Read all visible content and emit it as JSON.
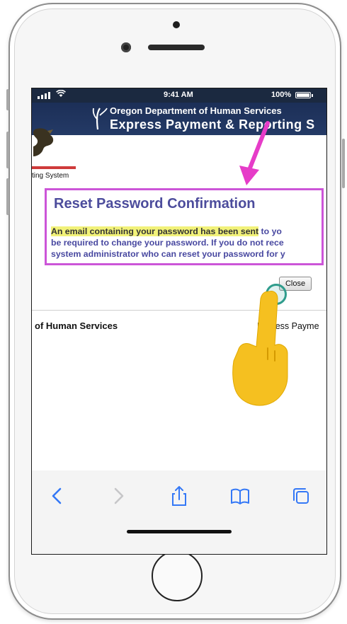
{
  "status_bar": {
    "time": "9:41 AM",
    "battery_percent": "100%",
    "battery_level": 1.0
  },
  "site_header": {
    "line1": "Oregon Department of Human Services",
    "line2": "Express Payment & Reporting S"
  },
  "site_subtitle": "ting System",
  "dialog": {
    "title": "Reset Password Confirmation",
    "message_highlighted": "An email containing your password has been sent",
    "message_rest_line1": " to yo",
    "message_line2": "be required to change your password. If you do not rece",
    "message_line3": "system administrator who can reset your password for y",
    "close_label": "Close"
  },
  "footer": {
    "left": "of Human Services",
    "right": "Express Payme"
  },
  "toolbar": {
    "icons": [
      "back-icon",
      "forward-icon",
      "share-icon",
      "bookmarks-icon",
      "tabs-icon"
    ]
  },
  "colors": {
    "header_bg": "#1c2f57",
    "dialog_border": "#cc55d8",
    "dialog_title": "#4c4c9c",
    "highlight": "#f2f279",
    "ios_blue": "#3478f6",
    "tap_ring": "#2f9c8c",
    "pointer_hand": "#f5c020",
    "arrow": "#e63cc8"
  }
}
